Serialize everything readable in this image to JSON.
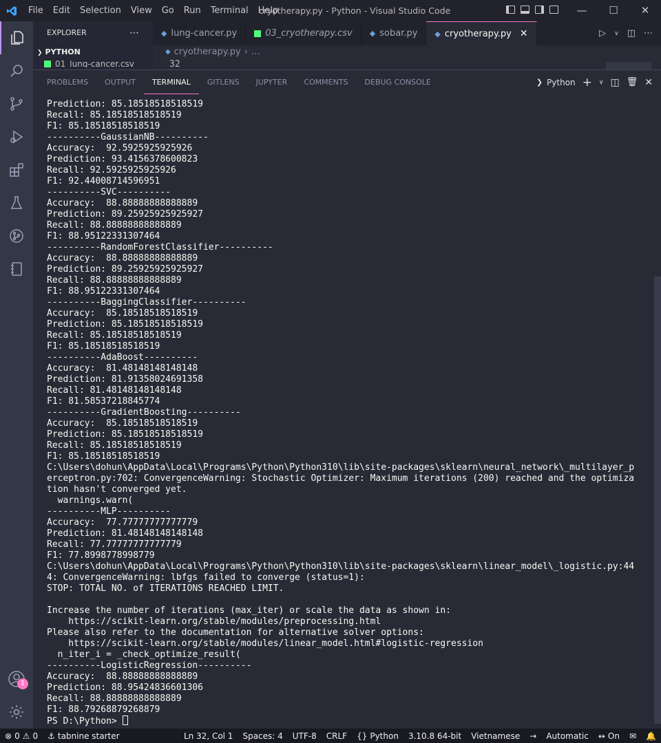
{
  "titlebar": {
    "menu": [
      "File",
      "Edit",
      "Selection",
      "View",
      "Go",
      "Run",
      "Terminal",
      "Help"
    ],
    "window_title": "cryotherapy.py - Python - Visual Studio Code"
  },
  "sidebar": {
    "title": "EXPLORER",
    "section": "PYTHON",
    "file": "01_lung-cancer.csv"
  },
  "tabs": [
    {
      "label": "lung-cancer.py"
    },
    {
      "label": "03_cryotherapy.csv"
    },
    {
      "label": "sobar.py"
    },
    {
      "label": "cryotherapy.py"
    }
  ],
  "editor": {
    "breadcrumb_file": "cryotherapy.py",
    "breadcrumb_more": "…",
    "line_number": "32"
  },
  "panel": {
    "tabs": [
      "PROBLEMS",
      "OUTPUT",
      "TERMINAL",
      "GITLENS",
      "JUPYTER",
      "COMMENTS",
      "DEBUG CONSOLE"
    ],
    "shell": "Python",
    "terminal_lines": [
      "Prediction: 85.18518518518519",
      "Recall: 85.18518518518519",
      "F1: 85.18518518518519",
      "----------GaussianNB----------",
      "Accuracy:  92.5925925925926",
      "Prediction: 93.4156378600823",
      "Recall: 92.5925925925926",
      "F1: 92.44008714596951",
      "----------SVC----------",
      "Accuracy:  88.88888888888889",
      "Prediction: 89.25925925925927",
      "Recall: 88.88888888888889",
      "F1: 88.95122331307464",
      "----------RandomForestClassifier----------",
      "Accuracy:  88.88888888888889",
      "Prediction: 89.25925925925927",
      "Recall: 88.88888888888889",
      "F1: 88.95122331307464",
      "----------BaggingClassifier----------",
      "Accuracy:  85.18518518518519",
      "Prediction: 85.18518518518519",
      "Recall: 85.18518518518519",
      "F1: 85.18518518518519",
      "----------AdaBoost----------",
      "Accuracy:  81.48148148148148",
      "Prediction: 81.91358024691358",
      "Recall: 81.48148148148148",
      "F1: 81.58537218845774",
      "----------GradientBoosting----------",
      "Accuracy:  85.18518518518519",
      "Prediction: 85.18518518518519",
      "Recall: 85.18518518518519",
      "F1: 85.18518518518519",
      "C:\\Users\\dohun\\AppData\\Local\\Programs\\Python\\Python310\\lib\\site-packages\\sklearn\\neural_network\\_multilayer_p",
      "erceptron.py:702: ConvergenceWarning: Stochastic Optimizer: Maximum iterations (200) reached and the optimiza",
      "tion hasn't converged yet.",
      "  warnings.warn(",
      "----------MLP----------",
      "Accuracy:  77.77777777777779",
      "Prediction: 81.48148148148148",
      "Recall: 77.77777777777779",
      "F1: 77.8998778998779",
      "C:\\Users\\dohun\\AppData\\Local\\Programs\\Python\\Python310\\lib\\site-packages\\sklearn\\linear_model\\_logistic.py:44",
      "4: ConvergenceWarning: lbfgs failed to converge (status=1):",
      "STOP: TOTAL NO. of ITERATIONS REACHED LIMIT.",
      "",
      "Increase the number of iterations (max_iter) or scale the data as shown in:",
      "    https://scikit-learn.org/stable/modules/preprocessing.html",
      "Please also refer to the documentation for alternative solver options:",
      "    https://scikit-learn.org/stable/modules/linear_model.html#logistic-regression",
      "  n_iter_i = _check_optimize_result(",
      "----------LogisticRegression----------",
      "Accuracy:  88.88888888888889",
      "Prediction: 88.95424836601306",
      "Recall: 88.88888888888889",
      "F1: 88.79268879268879"
    ],
    "prompt": "PS D:\\Python> "
  },
  "activitybar": {
    "badge": "1"
  },
  "statusbar": {
    "errors": "0",
    "warnings": "0",
    "tabnine": "tabnine starter",
    "position": "Ln 32, Col 1",
    "spaces": "Spaces: 4",
    "encoding": "UTF-8",
    "eol": "CRLF",
    "language": "Python",
    "interpreter": "3.10.8 64-bit",
    "keyboard": "Vietnamese",
    "mode": "Automatic",
    "live": "On"
  },
  "colors": {
    "accent": "#ff79c6",
    "background": "#282a36",
    "activity_bar": "#343746",
    "status_bar": "#191a21",
    "vscode_blue": "#3ea6ff"
  }
}
